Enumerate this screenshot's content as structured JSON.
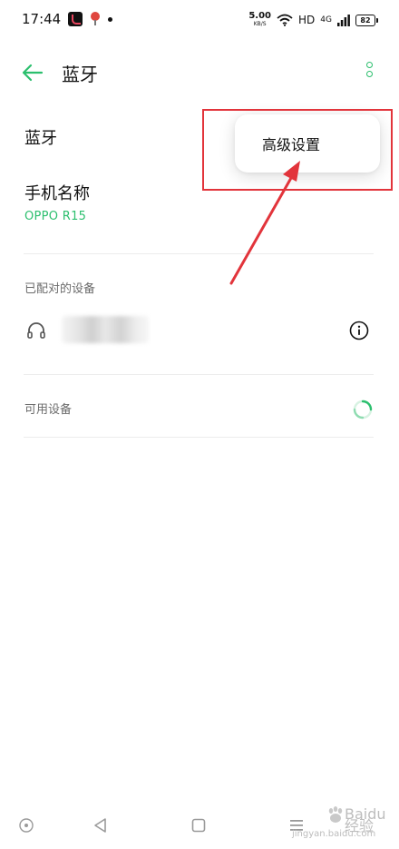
{
  "status_bar": {
    "time": "17:44",
    "net_speed_value": "5.00",
    "net_speed_unit": "KB/S",
    "network_label": "HD",
    "signal_label": "4G",
    "battery_level": "82"
  },
  "header": {
    "title": "蓝牙"
  },
  "settings": {
    "bluetooth_label": "蓝牙",
    "phone_name_label": "手机名称",
    "phone_name_value": "OPPO R15"
  },
  "paired_section": {
    "title": "已配对的设备"
  },
  "available_section": {
    "title": "可用设备"
  },
  "popup_menu": {
    "items": [
      "高级设置"
    ]
  },
  "watermark": {
    "text": "Baidu经验",
    "url": "jingyan.baidu.com"
  },
  "colors": {
    "accent": "#2cbf6e",
    "annotation": "#e2343b"
  }
}
